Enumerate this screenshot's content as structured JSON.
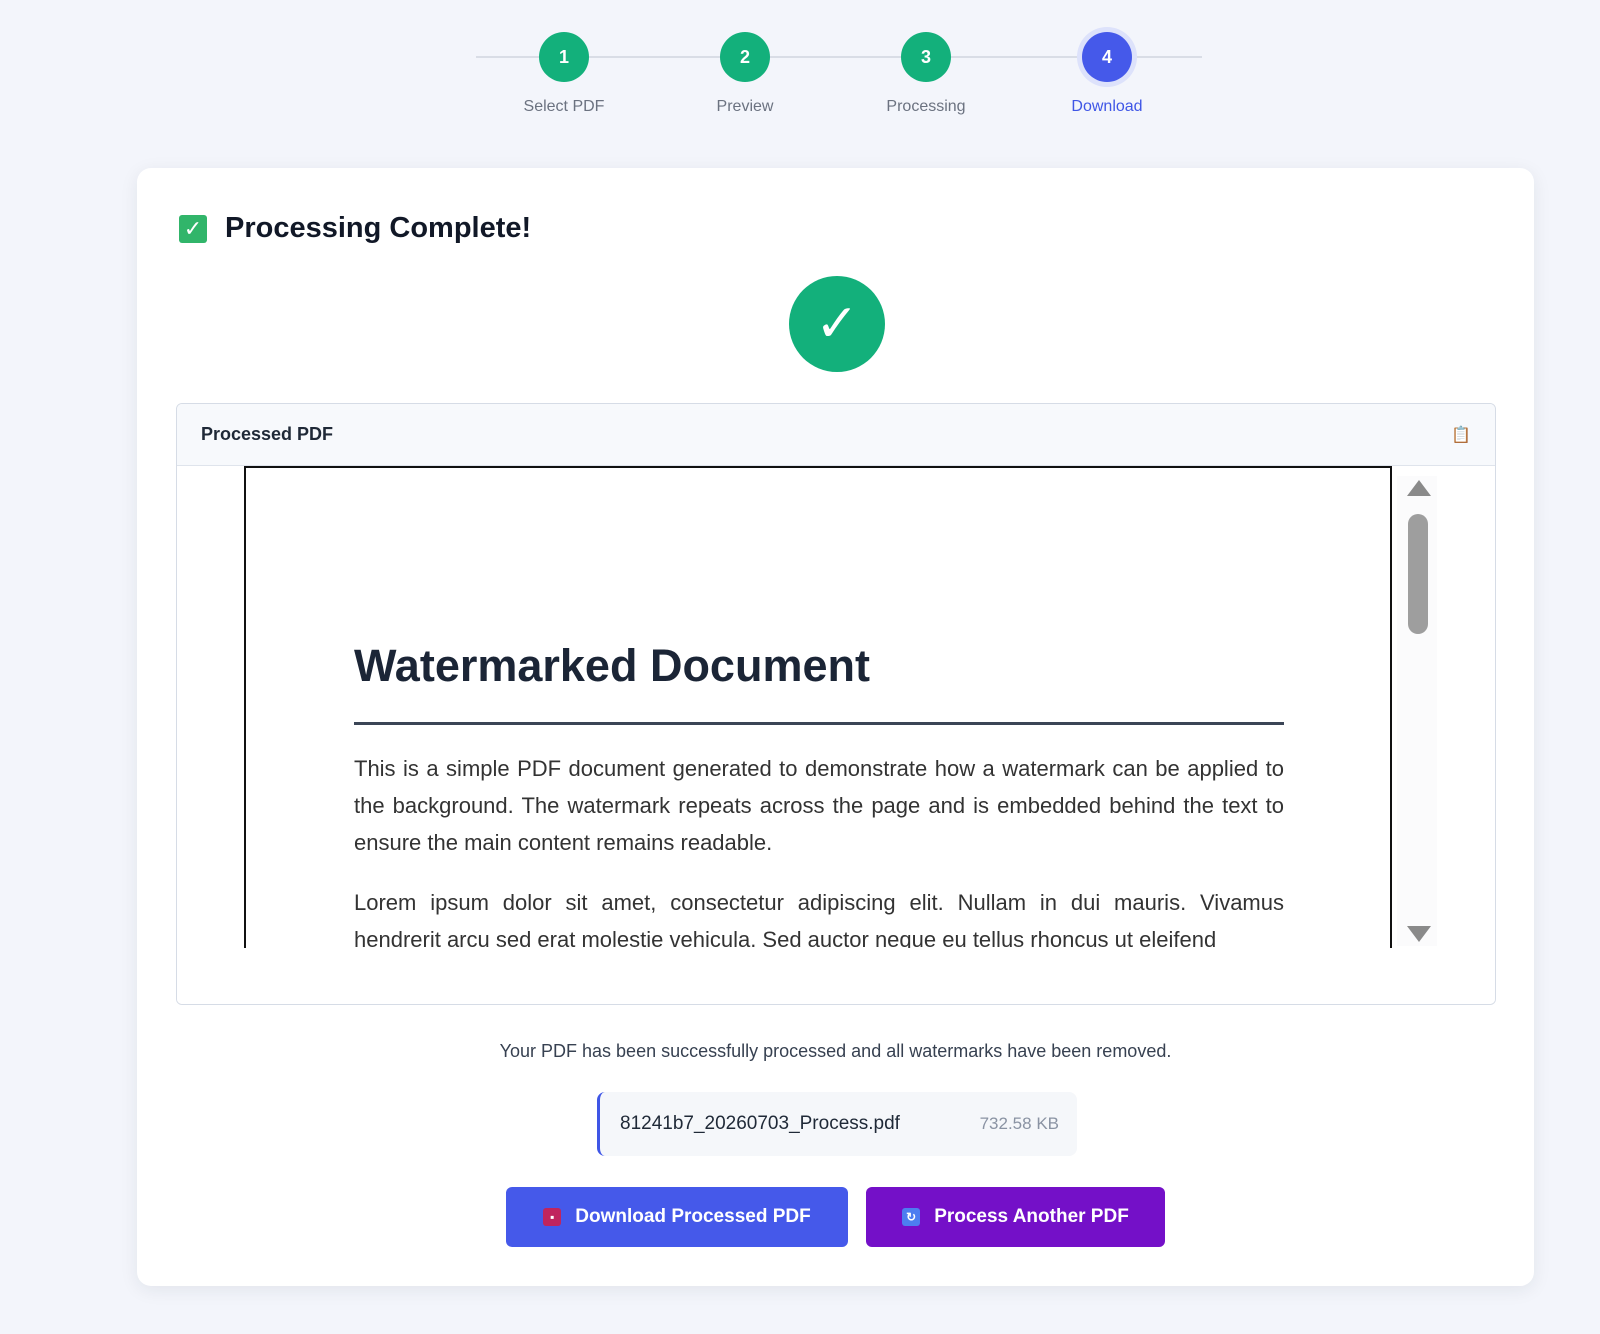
{
  "stepper": {
    "steps": [
      {
        "number": "1",
        "label": "Select PDF",
        "state": "completed"
      },
      {
        "number": "2",
        "label": "Preview",
        "state": "completed"
      },
      {
        "number": "3",
        "label": "Processing",
        "state": "completed"
      },
      {
        "number": "4",
        "label": "Download",
        "state": "active"
      }
    ]
  },
  "card": {
    "title": "Processing Complete!",
    "title_icon": "check-box-icon",
    "success_icon": "✓"
  },
  "viewer": {
    "title": "Processed PDF",
    "header_icon": "clipboard-icon",
    "document": {
      "heading": "Watermarked Document",
      "paragraphs": [
        "This is a simple PDF document generated to demonstrate how a watermark can be applied to the background. The watermark repeats across the page and is embedded behind the text to ensure the main content remains readable.",
        "Lorem ipsum dolor sit amet, consectetur adipiscing elit. Nullam in dui mauris. Vivamus hendrerit arcu sed erat molestie vehicula. Sed auctor neque eu tellus rhoncus ut eleifend"
      ]
    }
  },
  "result": {
    "message": "Your PDF has been successfully processed and all watermarks have been removed.",
    "file_name": "81241b7_20260703_Process.pdf",
    "file_size": "732.58 KB"
  },
  "actions": {
    "download_label": "Download Processed PDF",
    "download_icon": "floppy-disk-icon",
    "another_label": "Process Another PDF",
    "another_icon": "refresh-icon"
  },
  "colors": {
    "completed_step": "#13b07b",
    "active_step": "#4559ea",
    "download_button": "#4559ea",
    "another_button": "#7410c8"
  }
}
